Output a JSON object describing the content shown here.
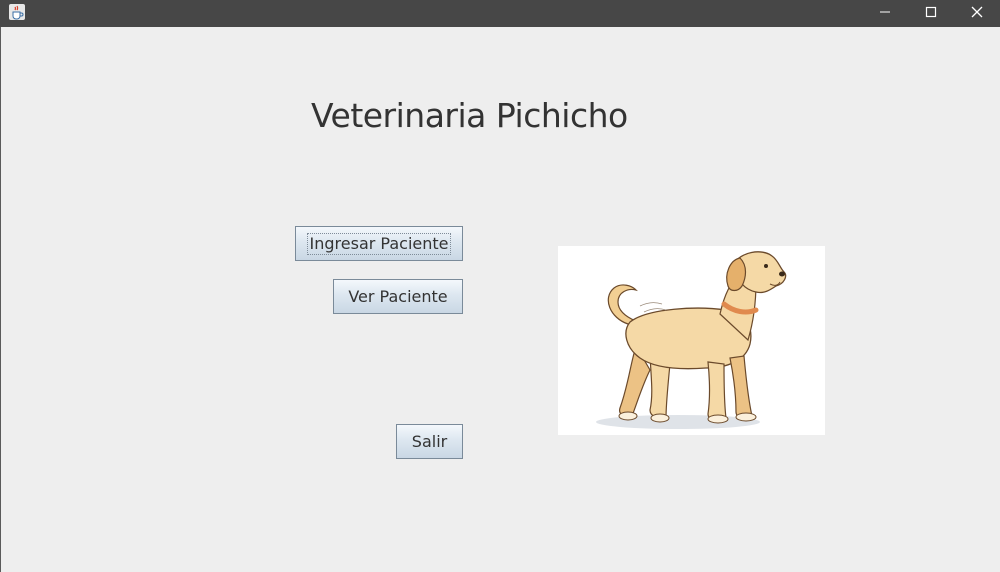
{
  "window": {
    "app_icon": "java-cup-icon",
    "controls": {
      "minimize_icon": "minimize-icon",
      "maximize_icon": "maximize-icon",
      "close_icon": "close-icon"
    }
  },
  "main": {
    "title": "Veterinaria Pichicho",
    "buttons": {
      "ingresar_label": "Ingresar Paciente",
      "ver_label": "Ver Paciente",
      "salir_label": "Salir"
    },
    "image": {
      "subject": "dog-illustration"
    }
  },
  "colors": {
    "titlebar": "#474747",
    "background": "#eeeeee",
    "text": "#333333",
    "button_border": "#7a8a99"
  }
}
